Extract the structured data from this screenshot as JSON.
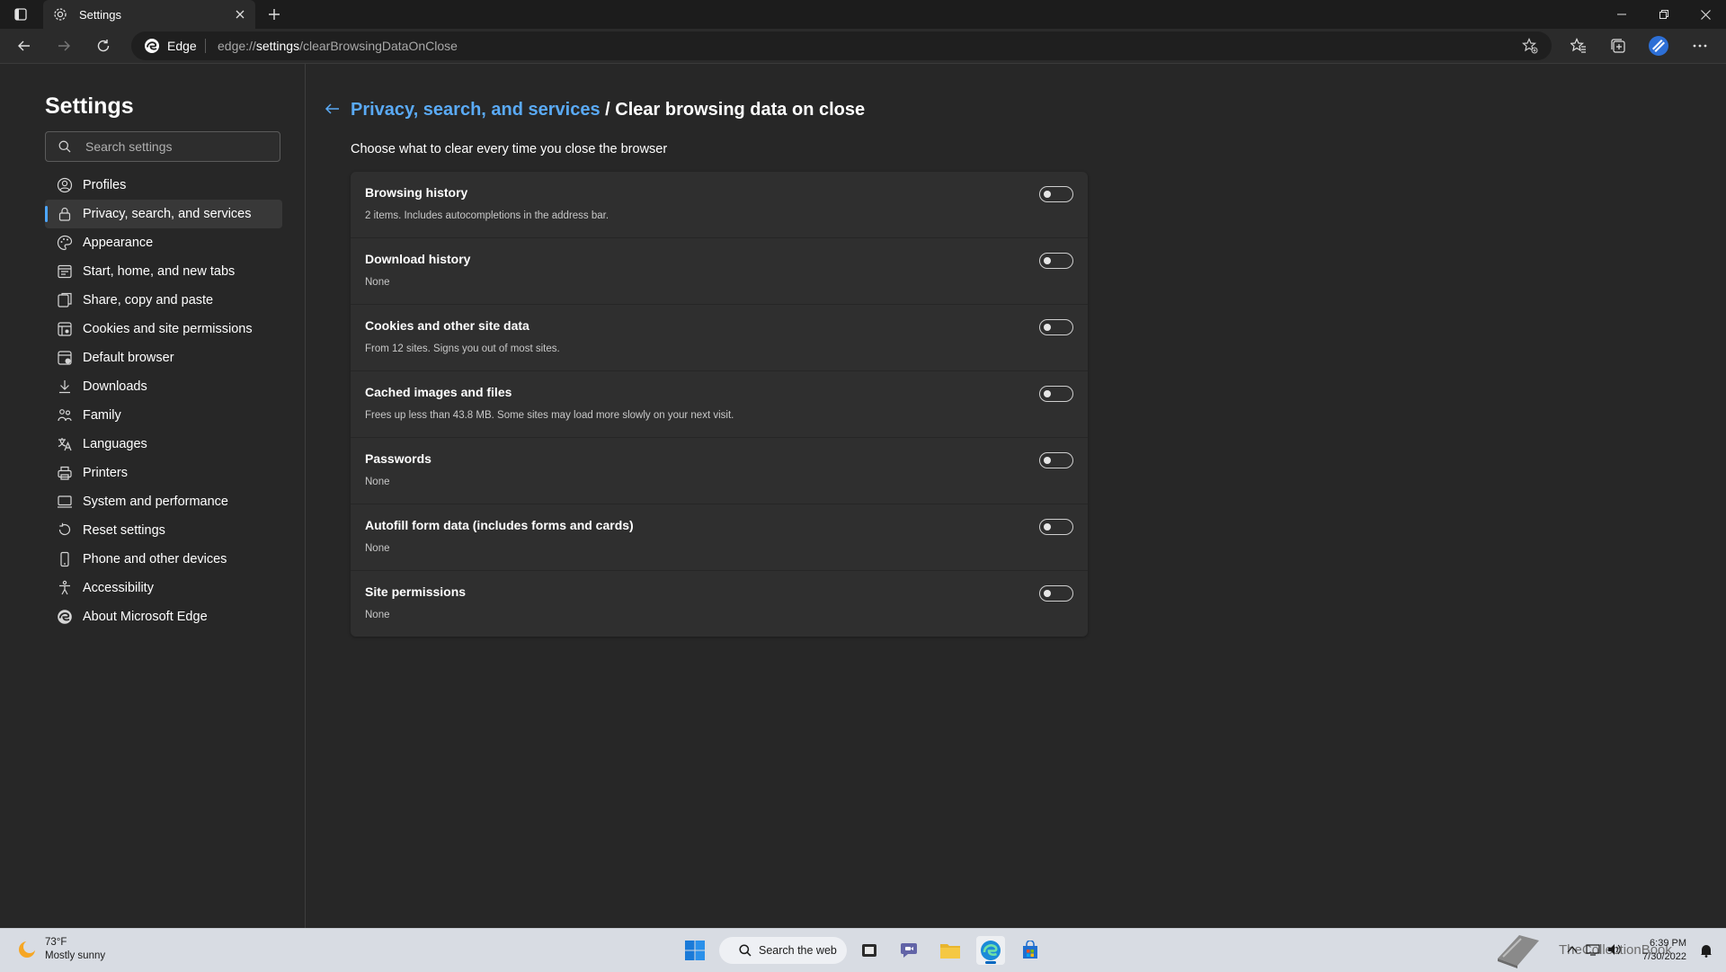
{
  "browser": {
    "tab_title": "Settings",
    "edge_label": "Edge",
    "url_prefix": "edge://",
    "url_host": "settings",
    "url_path": "/clearBrowsingDataOnClose"
  },
  "sidebar": {
    "title": "Settings",
    "search_placeholder": "Search settings",
    "items": [
      {
        "label": "Profiles",
        "icon": "profile-icon"
      },
      {
        "label": "Privacy, search, and services",
        "icon": "lock-icon",
        "active": true
      },
      {
        "label": "Appearance",
        "icon": "appearance-icon"
      },
      {
        "label": "Start, home, and new tabs",
        "icon": "start-home-icon"
      },
      {
        "label": "Share, copy and paste",
        "icon": "share-icon"
      },
      {
        "label": "Cookies and site permissions",
        "icon": "cookies-icon"
      },
      {
        "label": "Default browser",
        "icon": "default-browser-icon"
      },
      {
        "label": "Downloads",
        "icon": "download-icon"
      },
      {
        "label": "Family",
        "icon": "family-icon"
      },
      {
        "label": "Languages",
        "icon": "languages-icon"
      },
      {
        "label": "Printers",
        "icon": "printer-icon"
      },
      {
        "label": "System and performance",
        "icon": "system-icon"
      },
      {
        "label": "Reset settings",
        "icon": "reset-icon"
      },
      {
        "label": "Phone and other devices",
        "icon": "phone-icon"
      },
      {
        "label": "Accessibility",
        "icon": "accessibility-icon"
      },
      {
        "label": "About Microsoft Edge",
        "icon": "edge-logo-icon"
      }
    ]
  },
  "main": {
    "breadcrumb_link": "Privacy, search, and services",
    "breadcrumb_sep": " / ",
    "breadcrumb_current": "Clear browsing data on close",
    "description": "Choose what to clear every time you close the browser",
    "options": [
      {
        "title": "Browsing history",
        "desc": "2 items. Includes autocompletions in the address bar.",
        "enabled": false
      },
      {
        "title": "Download history",
        "desc": "None",
        "enabled": false
      },
      {
        "title": "Cookies and other site data",
        "desc": "From 12 sites. Signs you out of most sites.",
        "enabled": false
      },
      {
        "title": "Cached images and files",
        "desc": "Frees up less than 43.8 MB. Some sites may load more slowly on your next visit.",
        "enabled": false
      },
      {
        "title": "Passwords",
        "desc": "None",
        "enabled": false
      },
      {
        "title": "Autofill form data (includes forms and cards)",
        "desc": "None",
        "enabled": false
      },
      {
        "title": "Site permissions",
        "desc": "None",
        "enabled": false
      }
    ]
  },
  "taskbar": {
    "temperature": "73°F",
    "weather": "Mostly sunny",
    "search_label": "Search the web",
    "watermark": "TheCollectionBook",
    "time": "6:39 PM",
    "date": "7/30/2022"
  },
  "colors": {
    "accent": "#5aaaf5",
    "background": "#272727",
    "panel": "#2f2f2f"
  }
}
